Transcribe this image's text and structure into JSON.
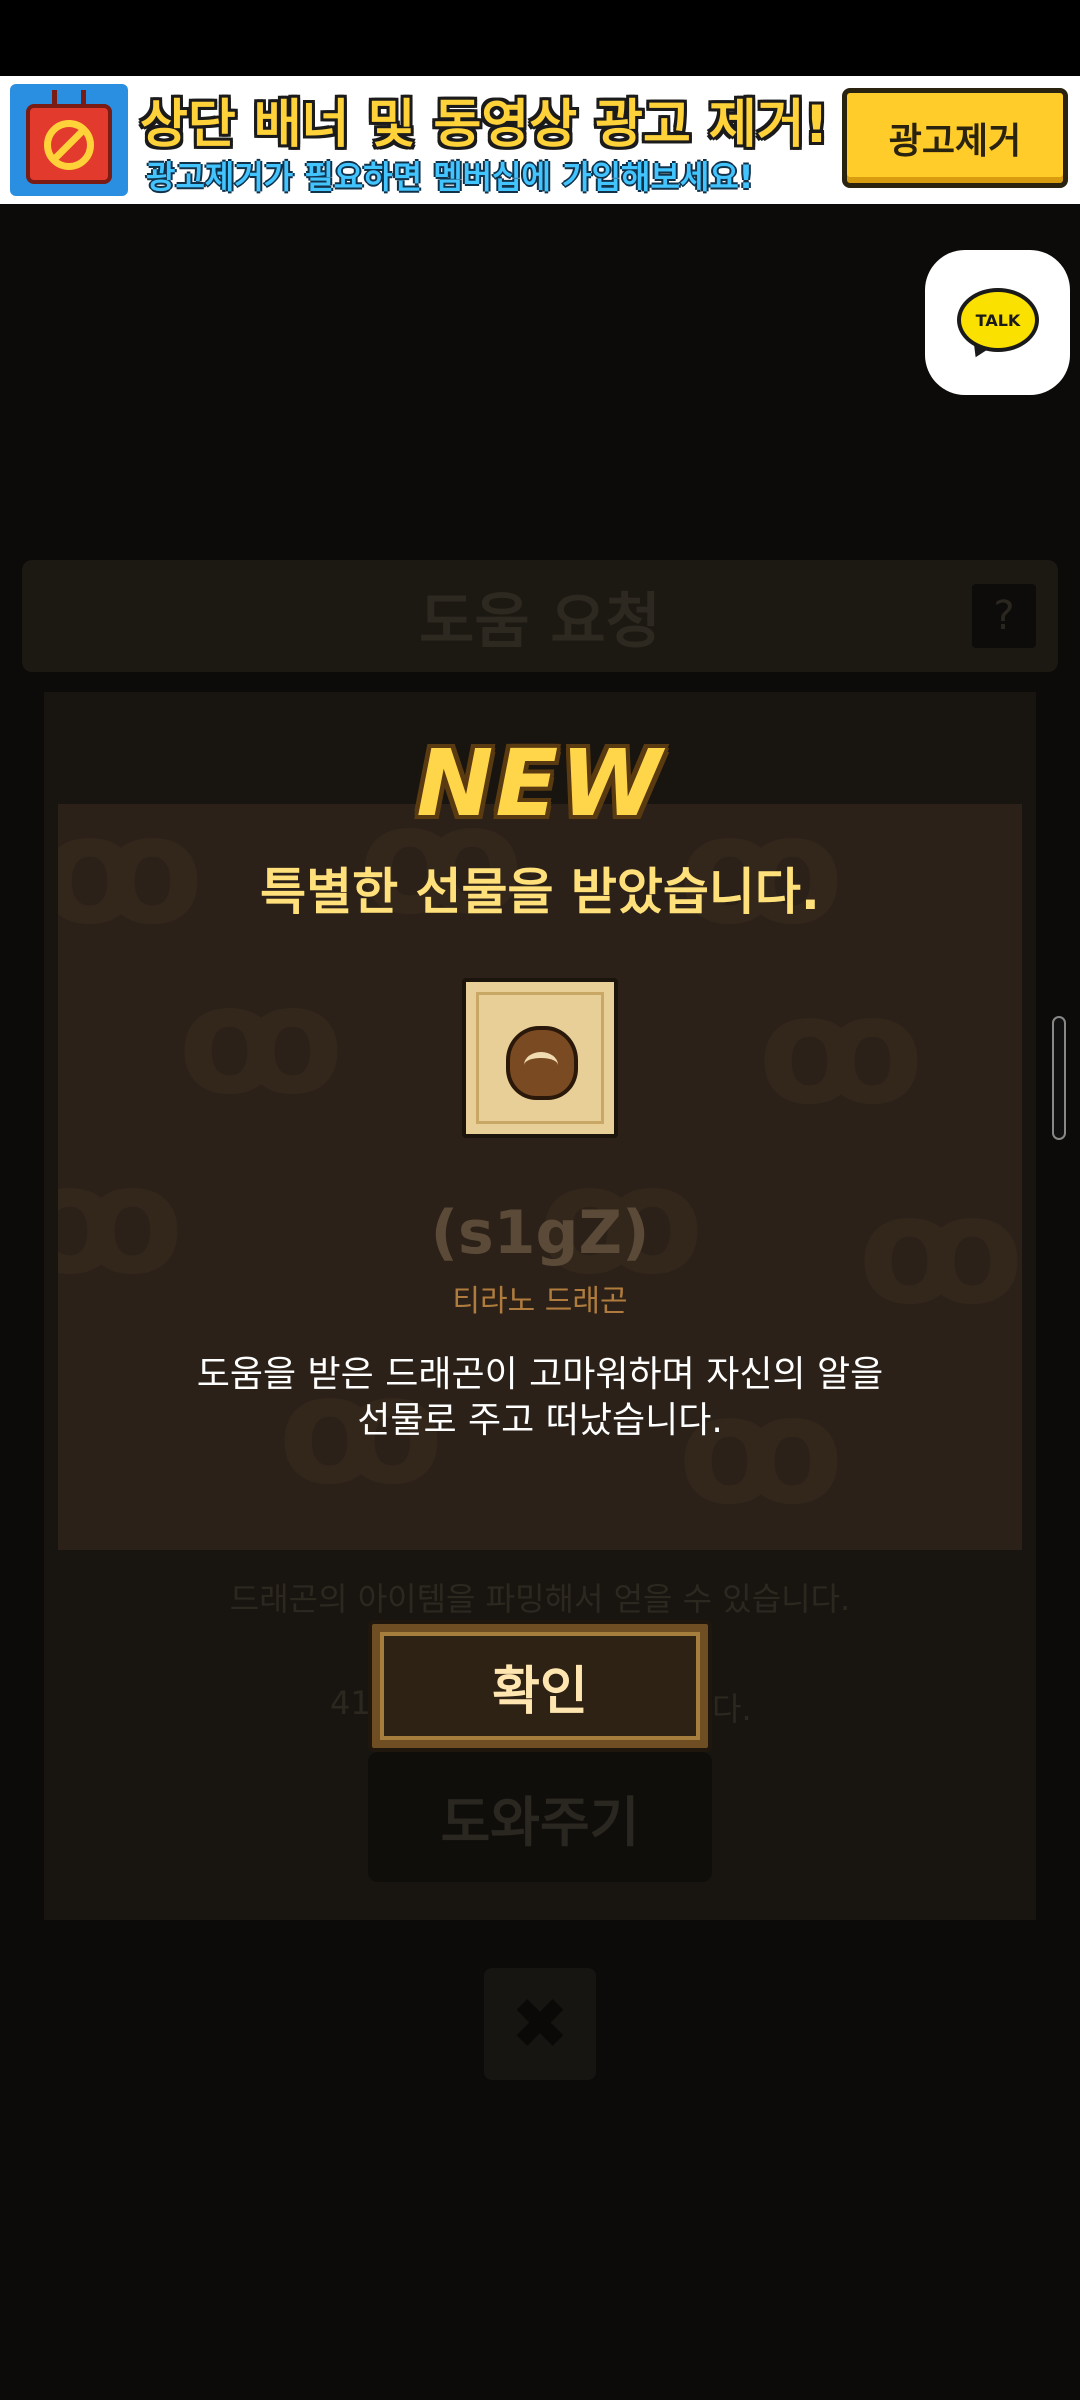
{
  "ad_banner": {
    "title": "상단 배너 및 동영상 광고 제거!",
    "subtitle": "광고제거가 필요하면 멤버십에 가입해보세요!",
    "button_label": "광고제거"
  },
  "kakao": {
    "label": "TALK"
  },
  "background": {
    "title": "도움 요청",
    "help_glyph": "?",
    "line1": "드래곤의 아이템을 파밍해서 얻을 수 있습니다.",
    "line2": "41",
    "line2_end": "다.",
    "help_button": "도와주기",
    "close_glyph": "✖"
  },
  "popup": {
    "badge": "NEW",
    "title": "특별한 선물을 받았습니다.",
    "item_name": "(s1gZ)",
    "item_type": "티라노 드래곤",
    "description_line1": "도움을 받은 드래곤이 고마워하며 자신의 알을",
    "description_line2": "선물로 주고 떠났습니다.",
    "confirm_label": "확인"
  },
  "colors": {
    "accent_gold": "#ffd54a",
    "popup_bg": "#2b2118",
    "kakao_yellow": "#fae100"
  }
}
